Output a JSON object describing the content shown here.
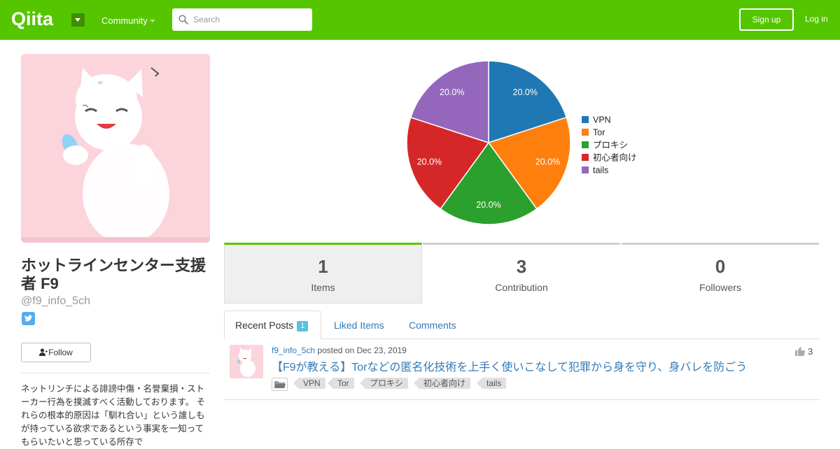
{
  "header": {
    "logo_text": "Qiita",
    "community_label": "Community",
    "search_placeholder": "Search",
    "signup_label": "Sign up",
    "login_label": "Log in",
    "brand_color": "#55c500"
  },
  "profile": {
    "display_name": "ホットラインセンター支援者 F9",
    "handle": "@f9_info_5ch",
    "follow_label": "Follow",
    "bio": "ネットリンチによる誹謗中傷・名誉棄損・ストーカー行為を撲滅すべく活動しております。 それらの根本的原因は「馴れ合い」という誰しもが持っている欲求であるという事実を一知ってもらいたいと思っている所存で"
  },
  "chart_data": {
    "type": "pie",
    "categories": [
      "VPN",
      "Tor",
      "プロキシ",
      "初心者向け",
      "tails"
    ],
    "values": [
      20.0,
      20.0,
      20.0,
      20.0,
      20.0
    ],
    "labels": [
      "20.0%",
      "20.0%",
      "20.0%",
      "20.0%",
      "20.0%"
    ],
    "colors": [
      "#1f77b4",
      "#ff7f0e",
      "#2ca02c",
      "#d62728",
      "#9467bd"
    ],
    "legend": "right"
  },
  "stats": [
    {
      "value": "1",
      "label": "Items"
    },
    {
      "value": "3",
      "label": "Contribution"
    },
    {
      "value": "0",
      "label": "Followers"
    }
  ],
  "tabs": {
    "recent_label": "Recent Posts",
    "recent_count": "1",
    "liked_label": "Liked Items",
    "comments_label": "Comments"
  },
  "post": {
    "author": "f9_info_5ch",
    "posted": "posted on Dec 23, 2019",
    "title": "【F9が教える】Torなどの匿名化技術を上手く使いこなして犯罪から身を守り、身バレを防ごう",
    "likes": "3",
    "tags": [
      "VPN",
      "Tor",
      "プロキシ",
      "初心者向け",
      "tails"
    ]
  }
}
